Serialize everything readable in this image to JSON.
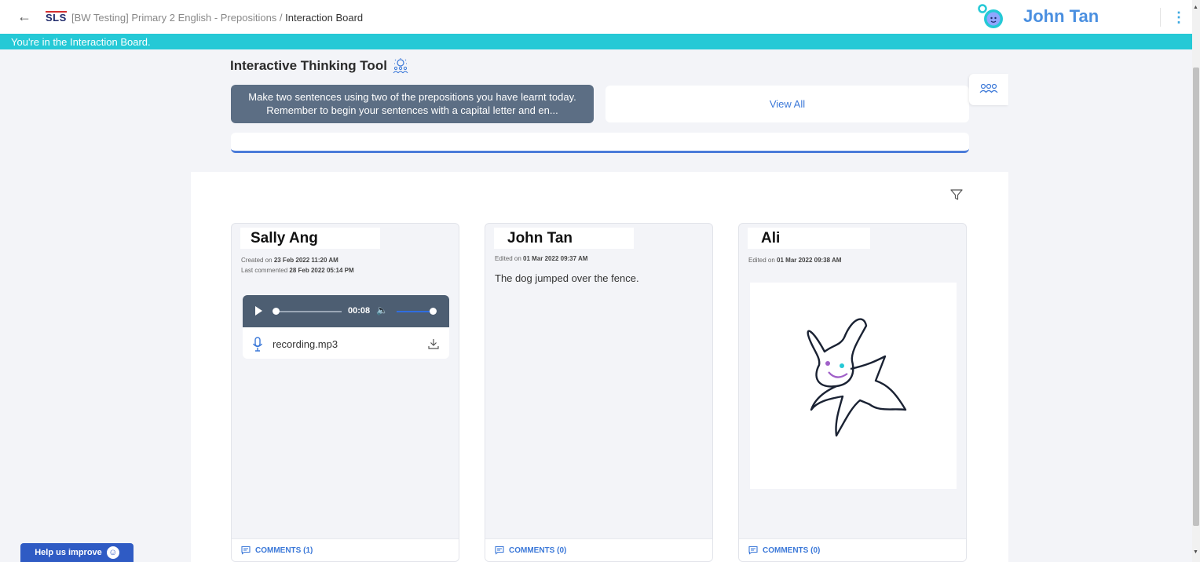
{
  "header": {
    "logo": "SLS",
    "breadcrumb_course": "[BW Testing] Primary 2 English - Prepositions",
    "breadcrumb_sep": " / ",
    "breadcrumb_current": "Interaction Board",
    "user_name": "John Tan"
  },
  "banner": {
    "text": "You're in the Interaction Board."
  },
  "tool": {
    "title": "Interactive Thinking Tool",
    "prompt": "Make two sentences using two of the prepositions you have learnt today. Remember to begin your sentences with a capital letter and en...",
    "view_all": "View All"
  },
  "cards": [
    {
      "name": "Sally Ang",
      "meta1_label": "Created on ",
      "meta1_value": "23 Feb 2022 11:20 AM",
      "meta2_label": "Last commented ",
      "meta2_value": "28 Feb 2022 05:14 PM",
      "audio_time": "00:08",
      "file_name": "recording.mp3",
      "comments": "COMMENTS (1)"
    },
    {
      "name": "John Tan",
      "meta1_label": "Edited on ",
      "meta1_value": "01 Mar 2022 09:37 AM",
      "text": "The dog jumped over the fence.",
      "comments": "COMMENTS (0)"
    },
    {
      "name": "Ali",
      "meta1_label": "Edited on ",
      "meta1_value": "01 Mar 2022 09:38 AM",
      "comments": "COMMENTS (0)"
    }
  ],
  "help": {
    "label": "Help us improve"
  },
  "colors": {
    "banner": "#25c9d6",
    "accent": "#3b78d8",
    "prompt_bg": "#5c6e84"
  }
}
